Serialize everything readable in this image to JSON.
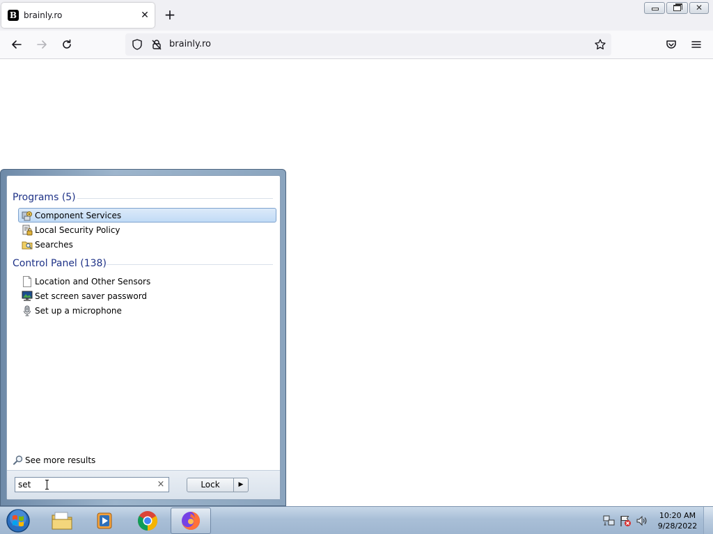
{
  "browser": {
    "tab_title": "brainly.ro",
    "favicon_letter": "B",
    "tab_close_glyph": "✕",
    "new_tab_glyph": "+",
    "url": "brainly.ro",
    "window_close_glyph": "✕"
  },
  "start_menu": {
    "programs_header": "Programs (5)",
    "programs": [
      {
        "label": "Component Services",
        "icon": "component-services-icon",
        "selected": true
      },
      {
        "label": "Local Security Policy",
        "icon": "security-policy-icon"
      },
      {
        "label": "Searches",
        "icon": "searches-folder-icon"
      }
    ],
    "control_panel_header": "Control Panel (138)",
    "control_panel": [
      {
        "label": "Location and Other Sensors",
        "icon": "document-icon"
      },
      {
        "label": "Set screen saver password",
        "icon": "monitor-icon"
      },
      {
        "label": "Set up a microphone",
        "icon": "microphone-icon"
      }
    ],
    "see_more_label": "See more results",
    "search_value": "set",
    "search_clear_glyph": "×",
    "lock_label": "Lock",
    "lock_arrow_glyph": "▶"
  },
  "taskbar": {
    "apps": [
      "windows-explorer",
      "media-player",
      "google-chrome",
      "firefox"
    ],
    "active_app": "firefox",
    "clock_time": "10:20 AM",
    "clock_date": "9/28/2022"
  },
  "colors": {
    "section_header": "#1e3287",
    "selection": "#c1dbf6",
    "firefox_toolbar": "#f9f9fb"
  }
}
